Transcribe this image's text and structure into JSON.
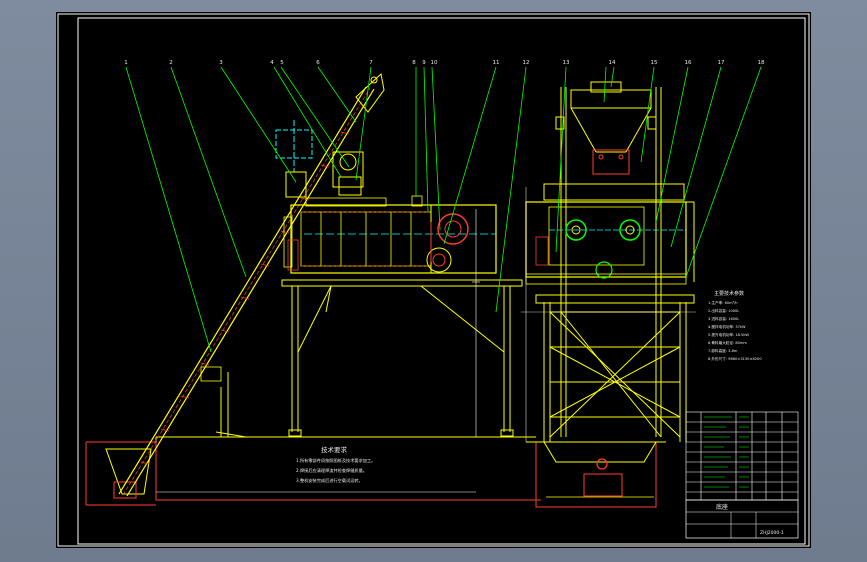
{
  "drawing": {
    "title_block": {
      "name": "底座",
      "code": "ZHJ2000-1"
    },
    "technical_requirements": {
      "title": "技术要求",
      "items": [
        "1.所有零部件须按照图纸及技术要求加工。",
        "2.焊接后应清理焊渣并检查焊缝质量。",
        "3.整机安装完成后进行空载试运转。"
      ]
    },
    "spec_notes": {
      "title": "主要技术参数",
      "lines": [
        "1.生产率: 60m³/h",
        "2.出料容量: 1000L",
        "3.进料容量: 1600L",
        "4.搅拌电机功率: 37kW",
        "5.提升电机功率: 18.5kW",
        "6.骨料最大粒径: 80mm",
        "7.卸料高度: 3.8m",
        "8.外形尺寸: 9860×3150×8200"
      ]
    },
    "balloons_side": [
      "1",
      "2",
      "3",
      "4",
      "5",
      "6",
      "7",
      "8",
      "9",
      "10",
      "11",
      "12"
    ],
    "balloons_front": [
      "13",
      "14",
      "15",
      "16",
      "17",
      "18"
    ]
  },
  "colors": {
    "frame": "#ffffff",
    "structure": "#ffff00",
    "leader": "#00ff00",
    "detail": "#ff3b30",
    "centerline": "#00ffff",
    "text": "#e8e8e8",
    "sheet": "#000000"
  }
}
